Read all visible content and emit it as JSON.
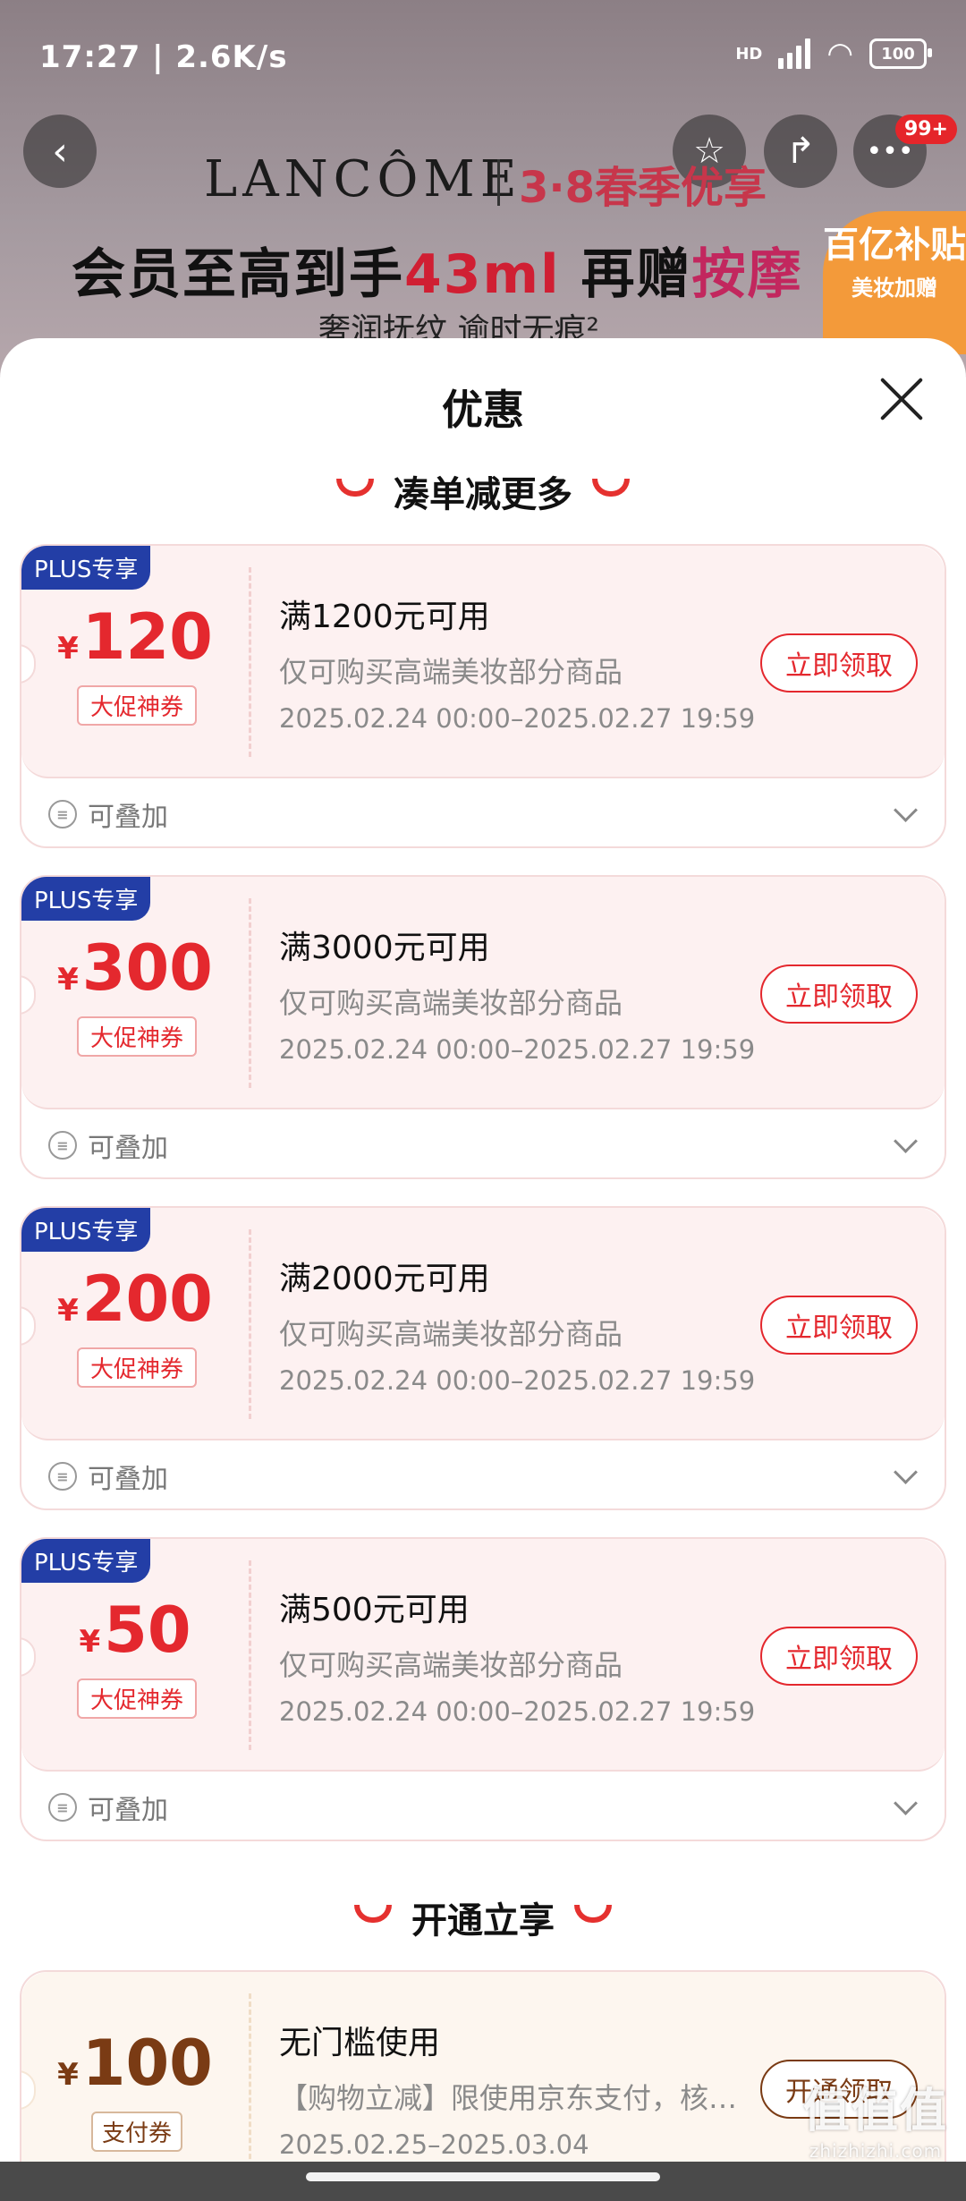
{
  "status_bar": {
    "time_speed": "17:27 | 2.6K/s",
    "network": "HD",
    "battery": "100"
  },
  "banner": {
    "brand": "LANCÔME",
    "campaign": "3·8春季优享",
    "headline_prefix": "会员至高到手",
    "headline_highlight": "43ml",
    "headline_suffix": " 再赠",
    "headline_end": "按摩",
    "tagline": "奢润抚纹 逾时无痕²",
    "subsidy_title": "百亿补贴",
    "subsidy_sub": "美妆加赠",
    "cart_badge": "99+"
  },
  "sheet": {
    "title": "优惠",
    "section1_title": "凑单减更多",
    "section2_title": "开通立享"
  },
  "coupons": [
    {
      "tag": "PLUS专享",
      "currency": "¥",
      "amount": "120",
      "type": "大促神券",
      "condition": "满1200元可用",
      "desc": "仅可购买高端美妆部分商品",
      "date": "2025.02.24 00:00–2025.02.27 19:59",
      "button": "立即领取",
      "stack": "可叠加"
    },
    {
      "tag": "PLUS专享",
      "currency": "¥",
      "amount": "300",
      "type": "大促神券",
      "condition": "满3000元可用",
      "desc": "仅可购买高端美妆部分商品",
      "date": "2025.02.24 00:00–2025.02.27 19:59",
      "button": "立即领取",
      "stack": "可叠加"
    },
    {
      "tag": "PLUS专享",
      "currency": "¥",
      "amount": "200",
      "type": "大促神券",
      "condition": "满2000元可用",
      "desc": "仅可购买高端美妆部分商品",
      "date": "2025.02.24 00:00–2025.02.27 19:59",
      "button": "立即领取",
      "stack": "可叠加"
    },
    {
      "tag": "PLUS专享",
      "currency": "¥",
      "amount": "50",
      "type": "大促神券",
      "condition": "满500元可用",
      "desc": "仅可购买高端美妆部分商品",
      "date": "2025.02.24 00:00–2025.02.27 19:59",
      "button": "立即领取",
      "stack": "可叠加"
    }
  ],
  "pay_coupon": {
    "currency": "¥",
    "amount": "100",
    "type": "支付券",
    "condition": "无门槛使用",
    "desc": "【购物立减】限使用京东支付，核…",
    "date": "2025.02.25–2025.03.04",
    "button": "开通领取"
  },
  "watermark": {
    "main": "值值值",
    "sub": "zhizhizhi.com"
  }
}
